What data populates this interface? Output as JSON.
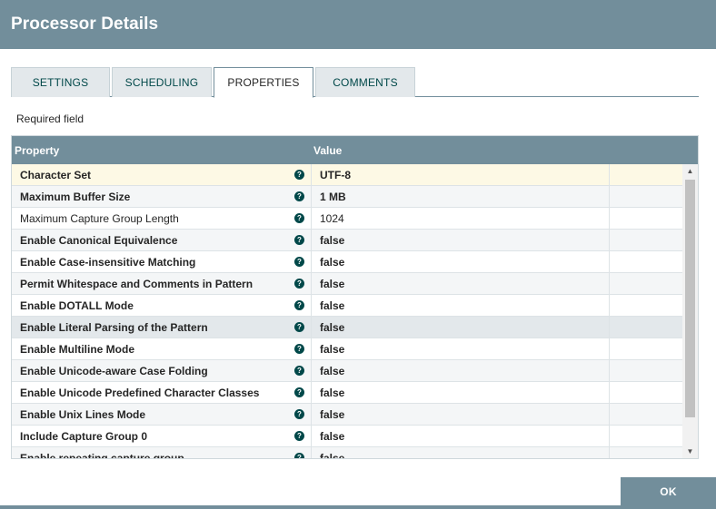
{
  "dialog": {
    "title": "Processor Details"
  },
  "tabs": [
    {
      "label": "SETTINGS",
      "active": false
    },
    {
      "label": "SCHEDULING",
      "active": false
    },
    {
      "label": "PROPERTIES",
      "active": true
    },
    {
      "label": "COMMENTS",
      "active": false
    }
  ],
  "required_field_label": "Required field",
  "grid": {
    "columns": {
      "property": "Property",
      "value": "Value"
    },
    "rows": [
      {
        "name": "Character Set",
        "value": "UTF-8",
        "required": true,
        "state": "selected"
      },
      {
        "name": "Maximum Buffer Size",
        "value": "1 MB",
        "required": true,
        "state": ""
      },
      {
        "name": "Maximum Capture Group Length",
        "value": "1024",
        "required": false,
        "state": ""
      },
      {
        "name": "Enable Canonical Equivalence",
        "value": "false",
        "required": true,
        "state": ""
      },
      {
        "name": "Enable Case-insensitive Matching",
        "value": "false",
        "required": true,
        "state": ""
      },
      {
        "name": "Permit Whitespace and Comments in Pattern",
        "value": "false",
        "required": true,
        "state": ""
      },
      {
        "name": "Enable DOTALL Mode",
        "value": "false",
        "required": true,
        "state": ""
      },
      {
        "name": "Enable Literal Parsing of the Pattern",
        "value": "false",
        "required": true,
        "state": "hover"
      },
      {
        "name": "Enable Multiline Mode",
        "value": "false",
        "required": true,
        "state": ""
      },
      {
        "name": "Enable Unicode-aware Case Folding",
        "value": "false",
        "required": true,
        "state": ""
      },
      {
        "name": "Enable Unicode Predefined Character Classes",
        "value": "false",
        "required": true,
        "state": ""
      },
      {
        "name": "Enable Unix Lines Mode",
        "value": "false",
        "required": true,
        "state": ""
      },
      {
        "name": "Include Capture Group 0",
        "value": "false",
        "required": true,
        "state": ""
      },
      {
        "name": "Enable repeating capture group",
        "value": "false",
        "required": true,
        "state": ""
      }
    ]
  },
  "footer": {
    "ok_label": "OK"
  },
  "colors": {
    "header": "#728e9b",
    "accent": "#004849",
    "selected_row": "#fdf9e5"
  },
  "icons": {
    "help": "question-circle-icon"
  }
}
